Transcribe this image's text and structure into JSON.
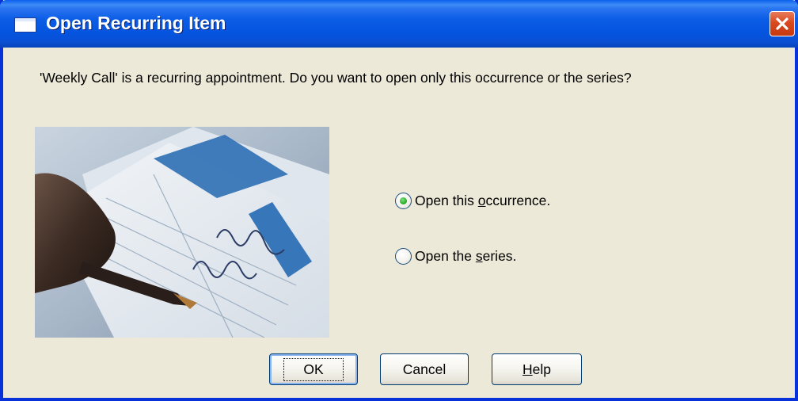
{
  "dialog": {
    "title": "Open Recurring Item",
    "message": "'Weekly Call' is a recurring appointment. Do you want to open only this occurrence or the series?"
  },
  "options": [
    {
      "label_before": "Open this ",
      "accesskey": "o",
      "label_after": "ccurrence.",
      "selected": true
    },
    {
      "label_before": "Open the ",
      "accesskey": "s",
      "label_after": "eries.",
      "selected": false
    }
  ],
  "buttons": {
    "ok": "OK",
    "cancel": "Cancel",
    "help_accesskey": "H",
    "help_rest": "elp"
  },
  "icons": {
    "title": "window-icon",
    "close": "close-icon"
  },
  "colors": {
    "titlebar": "#0554DF",
    "close": "#D9491F",
    "dialog_bg": "#ECE9D8",
    "radio_selected": "#2FB02F"
  }
}
